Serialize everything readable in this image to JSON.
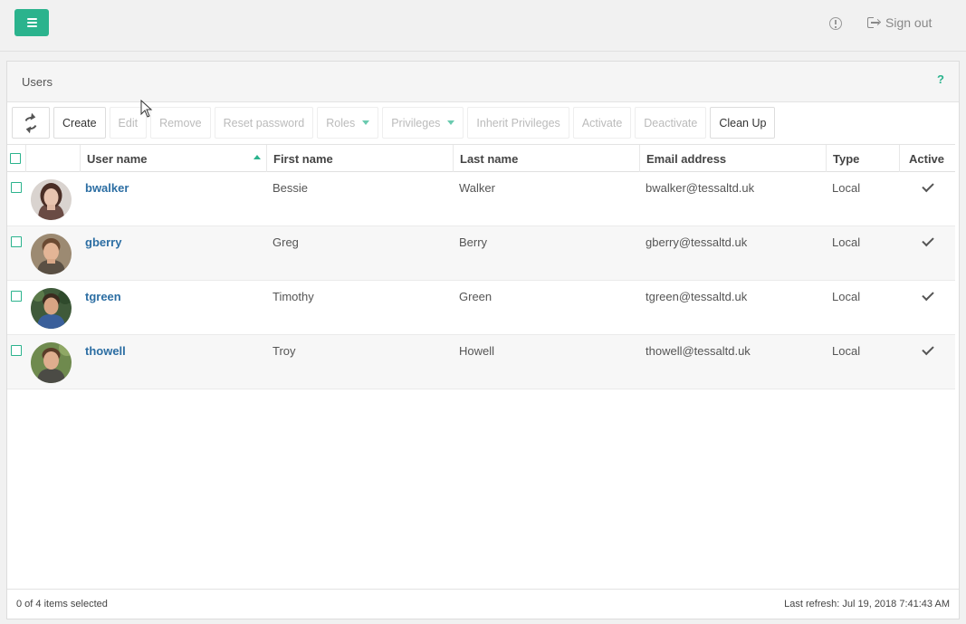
{
  "header": {
    "sign_out_label": "Sign out",
    "accent_color": "#2bb38d"
  },
  "panel": {
    "title": "Users",
    "help_label": "?"
  },
  "toolbar": {
    "create": "Create",
    "edit": "Edit",
    "remove": "Remove",
    "reset_password": "Reset password",
    "roles": "Roles",
    "privileges": "Privileges",
    "inherit_privileges": "Inherit Privileges",
    "activate": "Activate",
    "deactivate": "Deactivate",
    "clean_up": "Clean Up"
  },
  "table": {
    "columns": {
      "user_name": "User name",
      "first_name": "First name",
      "last_name": "Last name",
      "email": "Email address",
      "type": "Type",
      "active": "Active"
    },
    "rows": [
      {
        "username": "bwalker",
        "first_name": "Bessie",
        "last_name": "Walker",
        "email": "bwalker@tessaltd.uk",
        "type": "Local",
        "active": true
      },
      {
        "username": "gberry",
        "first_name": "Greg",
        "last_name": "Berry",
        "email": "gberry@tessaltd.uk",
        "type": "Local",
        "active": true
      },
      {
        "username": "tgreen",
        "first_name": "Timothy",
        "last_name": "Green",
        "email": "tgreen@tessaltd.uk",
        "type": "Local",
        "active": true
      },
      {
        "username": "thowell",
        "first_name": "Troy",
        "last_name": "Howell",
        "email": "thowell@tessaltd.uk",
        "type": "Local",
        "active": true
      }
    ]
  },
  "footer": {
    "selection": "0 of 4 items selected",
    "last_refresh": "Last refresh: Jul 19, 2018 7:41:43 AM"
  }
}
